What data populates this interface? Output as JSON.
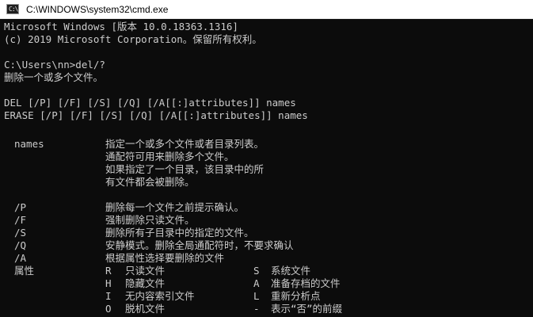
{
  "window": {
    "title": "C:\\WINDOWS\\system32\\cmd.exe",
    "icon": "cmd-icon",
    "icon_glyph": "C:\\",
    "colors": {
      "background": "#0c0c0c",
      "text": "#cccccc",
      "titlebar": "#ffffff"
    }
  },
  "console": {
    "header_line1": "Microsoft Windows [版本 10.0.18363.1316]",
    "header_line2": "(c) 2019 Microsoft Corporation。保留所有权利。",
    "prompt_line": "C:\\Users\\nn>del/?",
    "description": "删除一个或多个文件。",
    "syntax_del": "DEL [/P] [/F] [/S] [/Q] [/A[[:]attributes]] names",
    "syntax_erase": "ERASE [/P] [/F] [/S] [/Q] [/A[[:]attributes]] names",
    "names_param": "names",
    "names_desc": [
      "指定一个或多个文件或者目录列表。",
      "通配符可用来删除多个文件。",
      "如果指定了一个目录，该目录中的所",
      "有文件都会被删除。"
    ],
    "switches": [
      {
        "flag": "/P",
        "desc": "删除每一个文件之前提示确认。"
      },
      {
        "flag": "/F",
        "desc": "强制删除只读文件。"
      },
      {
        "flag": "/S",
        "desc": "删除所有子目录中的指定的文件。"
      },
      {
        "flag": "/Q",
        "desc": "安静模式。删除全局通配符时，不要求确认"
      },
      {
        "flag": "/A",
        "desc": "根据属性选择要删除的文件"
      }
    ],
    "attributes_label": "属性",
    "attributes": [
      {
        "c1": "R",
        "d1": "只读文件",
        "c2": "S",
        "d2": "系统文件"
      },
      {
        "c1": "H",
        "d1": "隐藏文件",
        "c2": "A",
        "d2": "准备存档的文件"
      },
      {
        "c1": "I",
        "d1": "无内容索引文件",
        "c2": "L",
        "d2": "重新分析点"
      },
      {
        "c1": "O",
        "d1": "脱机文件",
        "c2": "-",
        "d2": "表示“否”的前缀"
      }
    ]
  }
}
